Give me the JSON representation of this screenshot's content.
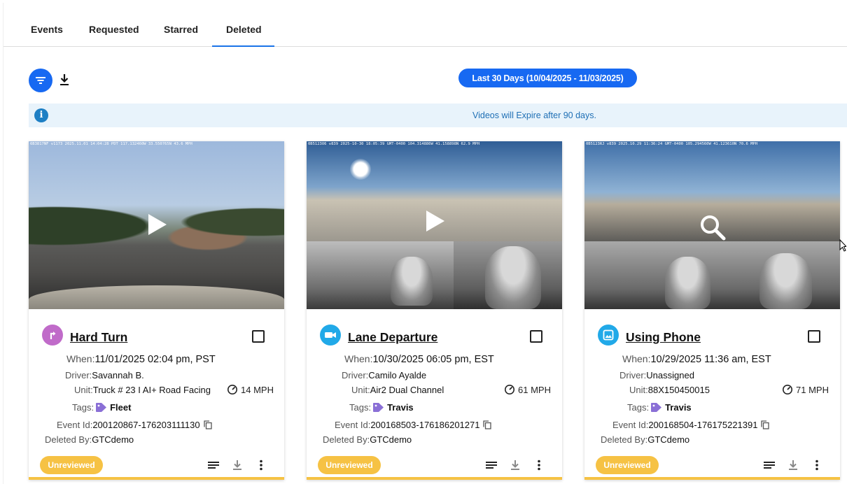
{
  "tabs": [
    {
      "label": "Events"
    },
    {
      "label": "Requested"
    },
    {
      "label": "Starred"
    },
    {
      "label": "Deleted",
      "active": true
    }
  ],
  "toolbar": {
    "filter_icon": "filter-icon",
    "download_icon": "download-icon",
    "date_range": "Last 30 Days (10/04/2025 - 11/03/2025)"
  },
  "info": {
    "icon": "info-icon",
    "message": "Videos will Expire after 90 days."
  },
  "colors": {
    "primary": "#1769f2",
    "badge_unreviewed": "#f6c244",
    "hard_turn": "#c06bc9",
    "lane_departure": "#21a9e8",
    "using_phone": "#21a9e8",
    "tag": "#8a6fd6"
  },
  "cards": [
    {
      "title": "Hard Turn",
      "type_icon": "turn-arrow-icon",
      "camera_stamp": "6B3817NF v1173 2025.11.01 14:04:28 PDT 117.132460W 33.550765N 43.6 MPH",
      "media_action": "play",
      "when_label": "When:",
      "when": "11/01/2025 02:04 pm, PST",
      "driver_label": "Driver:",
      "driver": "Savannah B.",
      "unit_label": "Unit:",
      "unit": "Truck # 23 I AI+ Road Facing",
      "speed": "14 MPH",
      "tags_label": "Tags:",
      "tag": "Fleet",
      "event_id_label": "Event Id:",
      "event_id": "200120867-176203111130",
      "deleted_by_label": "Deleted By:",
      "deleted_by": "GTCdemo",
      "status": "Unreviewed"
    },
    {
      "title": "Lane Departure",
      "type_icon": "video-camera-icon",
      "camera_stamp": "0B5123O6 v839 2025-10-30 18:05:39 GMT-0400 104.314886W 41.158898N 62.9 MPH",
      "media_action": "play",
      "when_label": "When:",
      "when": "10/30/2025 06:05 pm, EST",
      "driver_label": "Driver:",
      "driver": "Camilo Ayalde",
      "unit_label": "Unit:",
      "unit": "Air2 Dual Channel",
      "speed": "61 MPH",
      "tags_label": "Tags:",
      "tag": "Travis",
      "event_id_label": "Event Id:",
      "event_id": "200168503-176186201271",
      "deleted_by_label": "Deleted By:",
      "deleted_by": "GTCdemo",
      "status": "Unreviewed"
    },
    {
      "title": "Using Phone",
      "type_icon": "image-icon",
      "camera_stamp": "0B5123RJ v839 2025.10.29 11:36:24 GMT-0400 105.294560W 41.123610N 70.6 MPH",
      "media_action": "search",
      "when_label": "When:",
      "when": "10/29/2025 11:36 am, EST",
      "driver_label": "Driver:",
      "driver": "Unassigned",
      "unit_label": "Unit:",
      "unit": "88X150450015",
      "speed": "71 MPH",
      "tags_label": "Tags:",
      "tag": "Travis",
      "event_id_label": "Event Id:",
      "event_id": "200168504-176175221391",
      "deleted_by_label": "Deleted By:",
      "deleted_by": "GTCdemo",
      "status": "Unreviewed"
    }
  ]
}
